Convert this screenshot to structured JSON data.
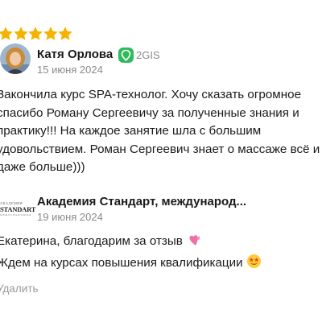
{
  "review": {
    "rating": 5,
    "colors": {
      "star": "#f5b301",
      "accent_green": "#2dbb5b",
      "muted": "#8a8a8a"
    },
    "author": {
      "name": "Катя Орлова",
      "avatar_icon": "user-photo-avatar"
    },
    "source": {
      "icon": "2gis-logo-icon",
      "name": "2GIS"
    },
    "date": "15 июня 2024",
    "text": "Закончила курс SPA-технолог. Хочу сказать огромное спасибо Роману Сергеевичу за полученные знания и практику!!! На каждое занятие шла с большим удовольствием. Роман Сергеевич знает о массаже всё и даже больше)))"
  },
  "reply": {
    "logo": {
      "line1": "АКАДЕМИЯ",
      "line2": "STANDART",
      "line3": "МЕЖДУНАРОДНАЯ"
    },
    "author": "Академия Стандарт, международ...",
    "date": "19 июня 2024",
    "lines": [
      {
        "text": "Екатерина, благодарим за отзыв",
        "emoji": "two-hearts-emoji"
      },
      {
        "text": "Ждем на курсах повышения квалификации",
        "emoji": "star-struck-emoji"
      }
    ],
    "delete_label": "Удалить"
  }
}
